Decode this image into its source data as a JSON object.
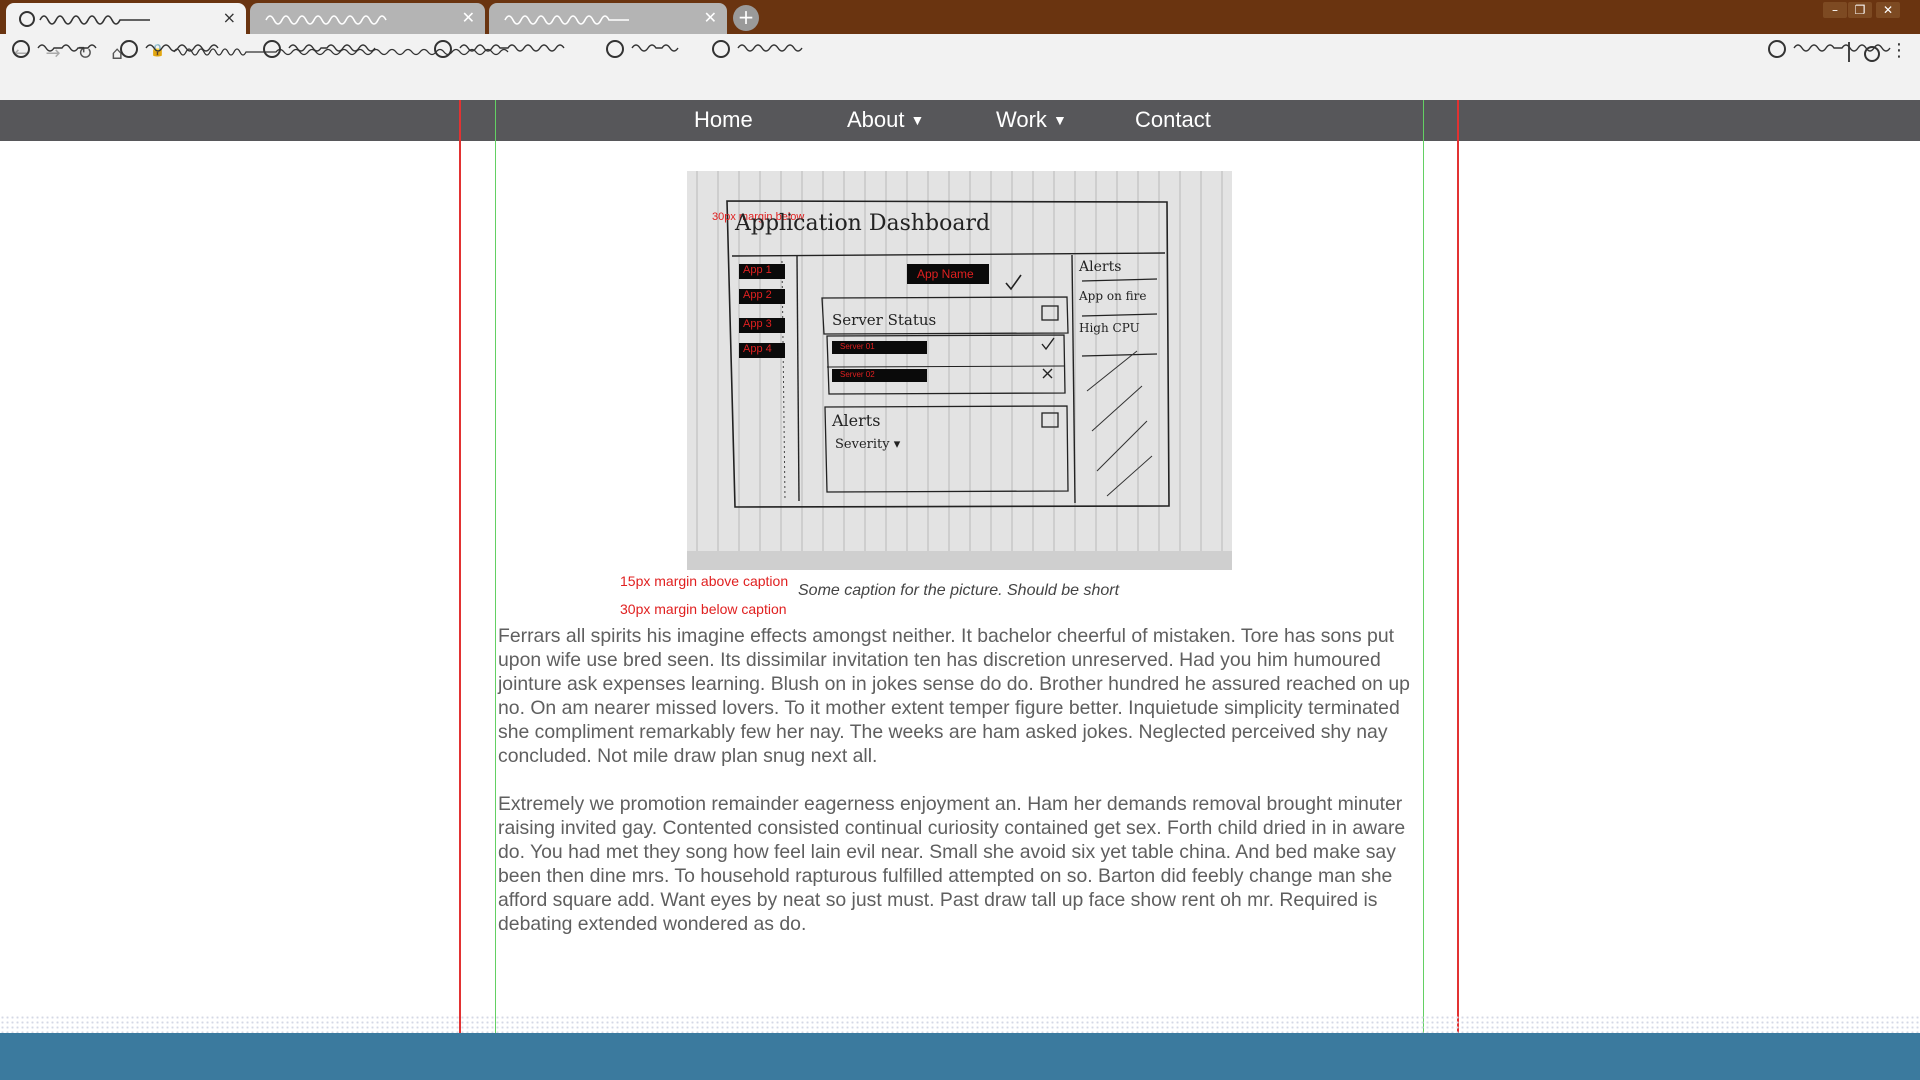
{
  "browser": {
    "tabs": [
      {
        "label": "",
        "active": true,
        "close_glyph": "×"
      },
      {
        "label": "",
        "active": false,
        "close_glyph": "✕"
      },
      {
        "label": "",
        "active": false,
        "close_glyph": "✕"
      }
    ],
    "new_tab_glyph": "+",
    "window_controls": [
      "–",
      "❐",
      "✕"
    ],
    "nav_icons": [
      "back-arrow-icon",
      "forward-arrow-icon",
      "reload-icon",
      "home-icon",
      "lock-icon"
    ],
    "nav_glyphs": {
      "back": "←",
      "forward": "→",
      "reload": "↻",
      "home": "⌂",
      "lock": "🔒",
      "menu": "⋮"
    }
  },
  "site_nav": {
    "items": [
      {
        "label": "Home",
        "caret": ""
      },
      {
        "label": "About",
        "caret": "▼"
      },
      {
        "label": "Work",
        "caret": "▼"
      },
      {
        "label": "Contact",
        "caret": ""
      }
    ]
  },
  "sketch": {
    "title": "Application Dashboard",
    "overlay_note": "30px margin below",
    "apps": [
      "App 1",
      "App 2",
      "App 3",
      "App 4"
    ],
    "app_name": "App Name",
    "server_status_label": "Server Status",
    "servers": [
      "Server 01",
      "Server 02"
    ],
    "alerts_label": "Alerts",
    "severity_label": "Severity ▾",
    "side_alerts_title": "Alerts",
    "side_alert_items": [
      "App on fire",
      "High CPU"
    ]
  },
  "annotations": {
    "above_caption": "15px margin above caption",
    "below_caption": "30px margin below caption"
  },
  "caption": "Some caption for the picture. Should be short",
  "paragraphs": [
    "Ferrars all spirits his imagine effects amongst neither. It bachelor cheerful of mistaken. Tore has sons put upon wife use bred seen. Its dissimilar invitation ten has discretion unreserved. Had you him humoured jointure ask expenses learning. Blush on in jokes sense do do. Brother hundred he assured reached on up no. On am nearer missed lovers. To it mother extent temper figure better. Inquietude simplicity terminated she compliment remarkably few her nay. The weeks are ham asked jokes. Neglected perceived shy nay concluded. Not mile draw plan snug next all.",
    "Extremely we promotion remainder eagerness enjoyment an. Ham her demands removal brought minuter raising invited gay. Contented consisted continual curiosity contained get sex. Forth child dried in in aware do. You had met they song how feel lain evil near. Small she avoid six yet table china. And bed make say been then dine mrs. To household rapturous fulfilled attempted on so. Barton did feebly change man she afford square add. Want eyes by neat so just must. Past draw tall up face show rent oh mr. Required is debating extended wondered as do."
  ],
  "colors": {
    "titlebar": "#6a3410",
    "nav_bar": "#57575a",
    "guide_red": "#e23232",
    "guide_green": "#63d063",
    "footer": "#3b7a9e",
    "annotation": "#e02020"
  }
}
